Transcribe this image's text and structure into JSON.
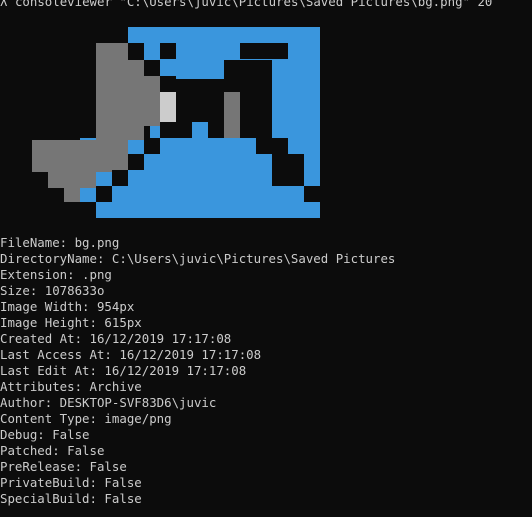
{
  "terminal": {
    "prompt_symbol": "λ",
    "command": "consoleviewer \"C:\\Users\\juvic\\Pictures\\Saved Pictures\\bg.png\" 20"
  },
  "image_preview": {
    "icon": "bg-image-pixel-preview",
    "colors": {
      "blue": "#3a96dd",
      "gray": "#767676",
      "light": "#cccccc",
      "black": "#0c0c0c"
    }
  },
  "file_info": {
    "lines": [
      "FileName: bg.png",
      "DirectoryName: C:\\Users\\juvic\\Pictures\\Saved Pictures",
      "Extension: .png",
      "Size: 1078633o",
      "Image Width: 954px",
      "Image Height: 615px",
      "Created At: 16/12/2019 17:17:08",
      "Last Access At: 16/12/2019 17:17:08",
      "Last Edit At: 16/12/2019 17:17:08",
      "Attributes: Archive",
      "Author: DESKTOP-SVF83D6\\juvic",
      "Content Type: image/png",
      "Debug: False",
      "Patched: False",
      "PreRelease: False",
      "PrivateBuild: False",
      "SpecialBuild: False"
    ]
  }
}
